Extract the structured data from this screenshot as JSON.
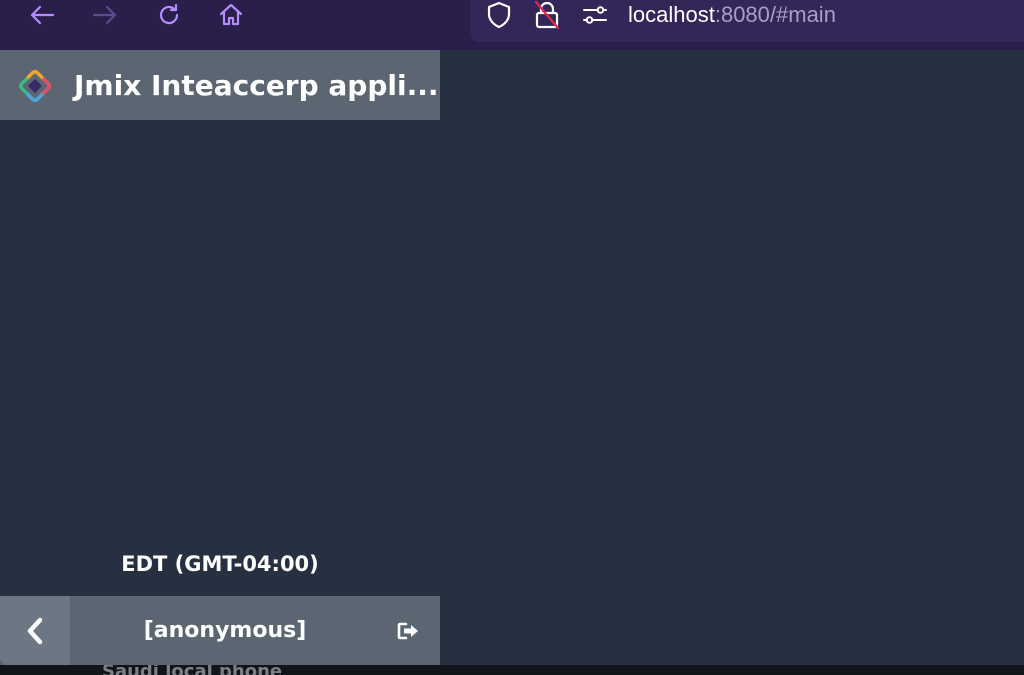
{
  "browser": {
    "url_host": "localhost",
    "url_rest": ":8080/#main",
    "icons": [
      "back-arrow-icon",
      "forward-arrow-icon",
      "reload-icon",
      "home-icon",
      "shield-icon",
      "lock-off-icon",
      "permissions-icon"
    ]
  },
  "app": {
    "title": "Jmix Inteaccerp appli...",
    "logo_icon": "jmix-logo-icon",
    "accent_color": "#b48cff"
  },
  "sidebar": {
    "timezone": "EDT (GMT-04:00)",
    "username": "[anonymous]",
    "collapse_icon": "chevron-left-icon",
    "logout_icon": "logout-icon"
  },
  "footer": {
    "partial_text": "Saudi local phone"
  }
}
